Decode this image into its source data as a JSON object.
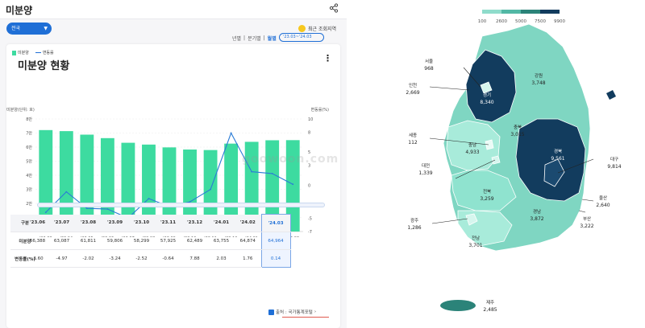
{
  "header": {
    "title": "미분양"
  },
  "controls": {
    "region": "전국",
    "recent_label": "최근 조회지역"
  },
  "card": {
    "title": "미분양 현황",
    "period_tabs": [
      "년별",
      "분기별",
      "월별"
    ],
    "period_sep": "|",
    "active_tab": "월별",
    "date_range": "'23.03~'24.03",
    "legend_bar": "미분양",
    "legend_line": "변동률"
  },
  "chart_data": {
    "type": "bar",
    "categories": [
      "'23.03",
      "'23.04",
      "'23.05",
      "'23.06",
      "'23.07",
      "'23.08",
      "'23.09",
      "'23.10",
      "'23.11",
      "'23.12",
      "'24.01",
      "'24.02",
      "'24.03"
    ],
    "series": [
      {
        "name": "미분양",
        "values": [
          72104,
          71365,
          68865,
          66388,
          63087,
          61811,
          59806,
          58299,
          57925,
          62489,
          63755,
          64874,
          64964
        ]
      },
      {
        "name": "변동률",
        "values": [
          -4.1,
          -1.0,
          -3.5,
          -3.6,
          -4.97,
          -2.02,
          -3.24,
          -2.52,
          -0.64,
          7.88,
          2.03,
          1.76,
          0.14
        ]
      }
    ],
    "ylabel": "미분양(단위: 호)",
    "y2label": "변동률(%)",
    "ylim": [
      0,
      80000
    ],
    "y2lim": [
      -7,
      10
    ],
    "yticks": [
      "0",
      "1만",
      "2만",
      "3만",
      "4만",
      "5만",
      "6만",
      "7만",
      "8만"
    ],
    "y2ticks": [
      "-7",
      "-5",
      "-3",
      "0",
      "3",
      "5",
      "8",
      "10"
    ]
  },
  "table": {
    "row_headers": [
      "구분",
      "미분양",
      "변동률(%)"
    ],
    "partial": [
      "'23.06",
      "66,388",
      "-3.60"
    ],
    "columns": [
      "'23.07",
      "'23.08",
      "'23.09",
      "'23.10",
      "'23.11",
      "'23.12",
      "'24.01",
      "'24.02",
      "'24.03"
    ],
    "unsold": [
      "63,087",
      "61,811",
      "59,806",
      "58,299",
      "57,925",
      "62,489",
      "63,755",
      "64,874",
      "64,964"
    ],
    "change": [
      "-4.97",
      "-2.02",
      "-3.24",
      "-2.52",
      "-0.64",
      "7.88",
      "2.03",
      "1.76",
      "0.14"
    ]
  },
  "source": "출처 : 국가통계포털",
  "watermark": "goowoon.com",
  "map": {
    "scale": [
      "100",
      "2600",
      "5000",
      "7500",
      "9900"
    ],
    "scale_colors": [
      "#c9f2e9",
      "#8fdccb",
      "#52b8a5",
      "#2b8379",
      "#123c5e"
    ],
    "regions": [
      {
        "name": "서울",
        "value": "968"
      },
      {
        "name": "인천",
        "value": "2,669"
      },
      {
        "name": "경기",
        "value": "8,340"
      },
      {
        "name": "강원",
        "value": "3,748"
      },
      {
        "name": "세종",
        "value": "112"
      },
      {
        "name": "충북",
        "value": "3,015"
      },
      {
        "name": "충남",
        "value": "4,933"
      },
      {
        "name": "경북",
        "value": "9,561"
      },
      {
        "name": "대전",
        "value": "1,339"
      },
      {
        "name": "대구",
        "value": "9,814"
      },
      {
        "name": "전북",
        "value": "3,259"
      },
      {
        "name": "울산",
        "value": "2,640"
      },
      {
        "name": "경남",
        "value": "3,872"
      },
      {
        "name": "부산",
        "value": "3,222"
      },
      {
        "name": "광주",
        "value": "1,286"
      },
      {
        "name": "전남",
        "value": "3,701"
      },
      {
        "name": "제주",
        "value": "2,485"
      }
    ]
  }
}
